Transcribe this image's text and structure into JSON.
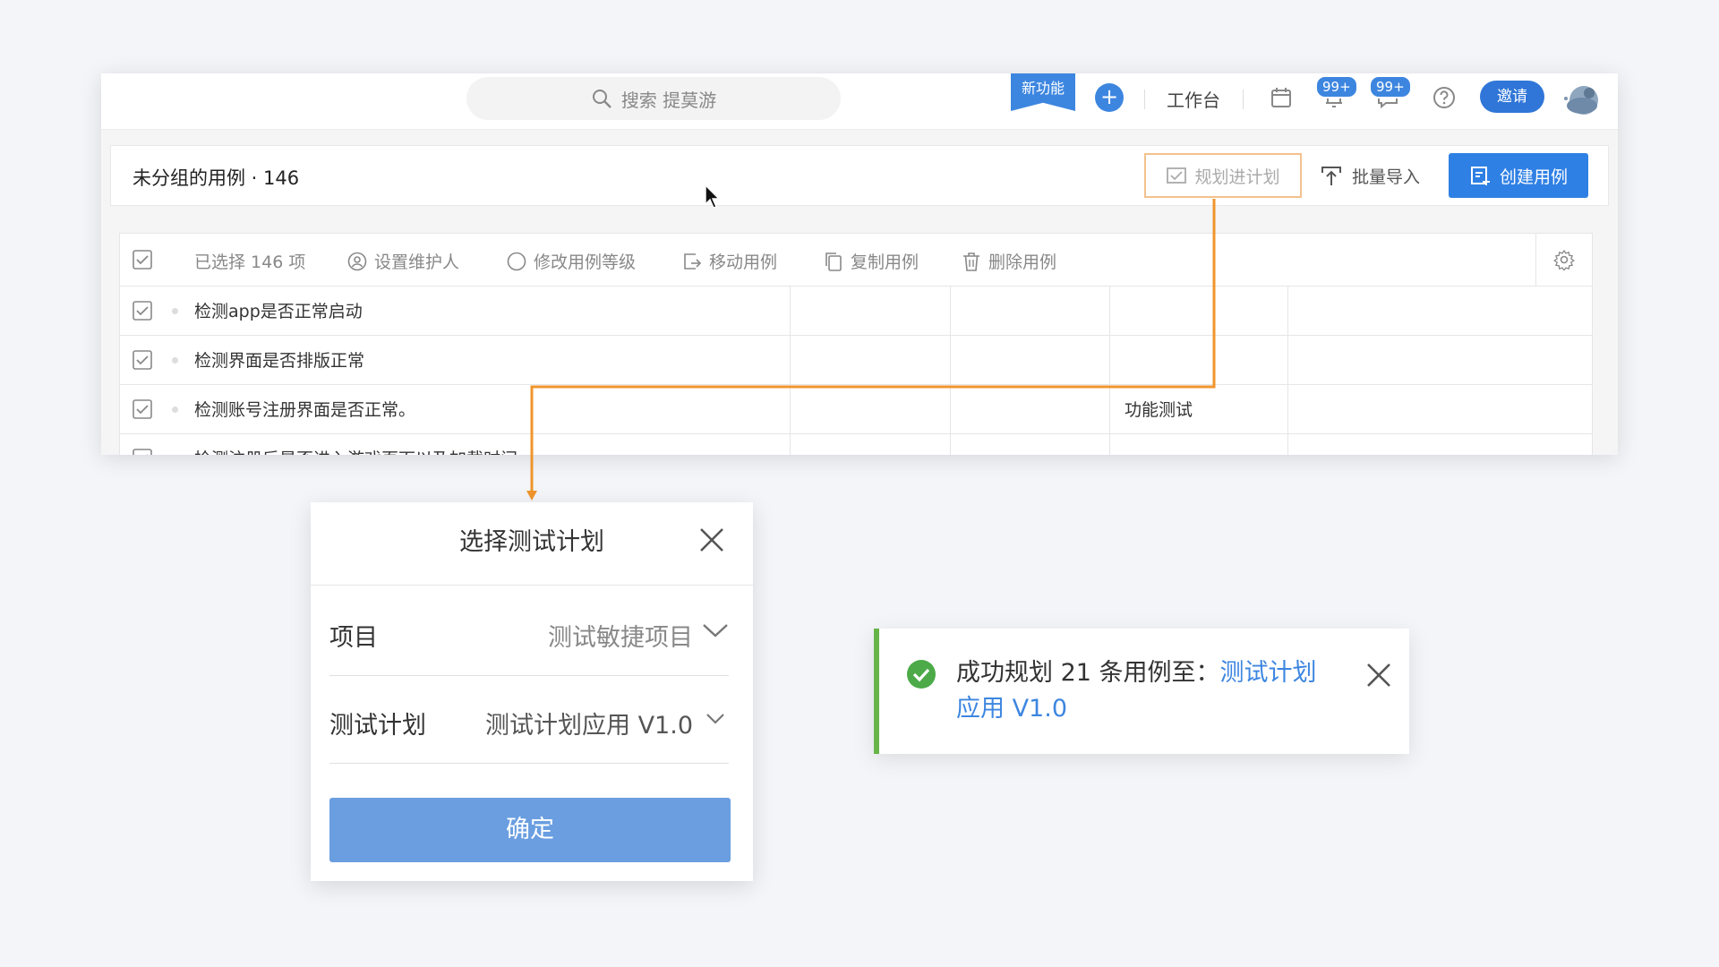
{
  "header": {
    "search_placeholder": "搜索 提莫游",
    "new_feature_label": "新功能",
    "workbench_label": "工作台",
    "notification_badge": "99+",
    "message_badge": "99+",
    "invite_label": "邀请"
  },
  "group_bar": {
    "title": "未分组的用例 · 146",
    "plan_label": "规划进计划",
    "import_label": "批量导入",
    "create_label": "创建用例"
  },
  "toolbar": {
    "selected_label": "已选择 146 项",
    "set_maintainer": "设置维护人",
    "change_level": "修改用例等级",
    "move_case": "移动用例",
    "copy_case": "复制用例",
    "delete_case": "删除用例"
  },
  "rows": [
    {
      "title": "检测app是否正常启动",
      "tag": ""
    },
    {
      "title": "检测界面是否排版正常",
      "tag": ""
    },
    {
      "title": "检测账号注册界面是否正常。",
      "tag": "功能测试"
    },
    {
      "title": "检测注册后是否进入游戏页面以及加载时间",
      "tag": ""
    }
  ],
  "dialog": {
    "title": "选择测试计划",
    "project_label": "项目",
    "project_value": "测试敏捷项目",
    "plan_label": "测试计划",
    "plan_value": "测试计划应用 V1.0",
    "confirm_label": "确定"
  },
  "toast": {
    "message": "成功规划 21 条用例至：",
    "link": "测试计划应用 V1.0"
  },
  "colors": {
    "primary": "#2f80e4",
    "connector": "#f0952c",
    "success": "#67b548",
    "link": "#3d86e0"
  }
}
